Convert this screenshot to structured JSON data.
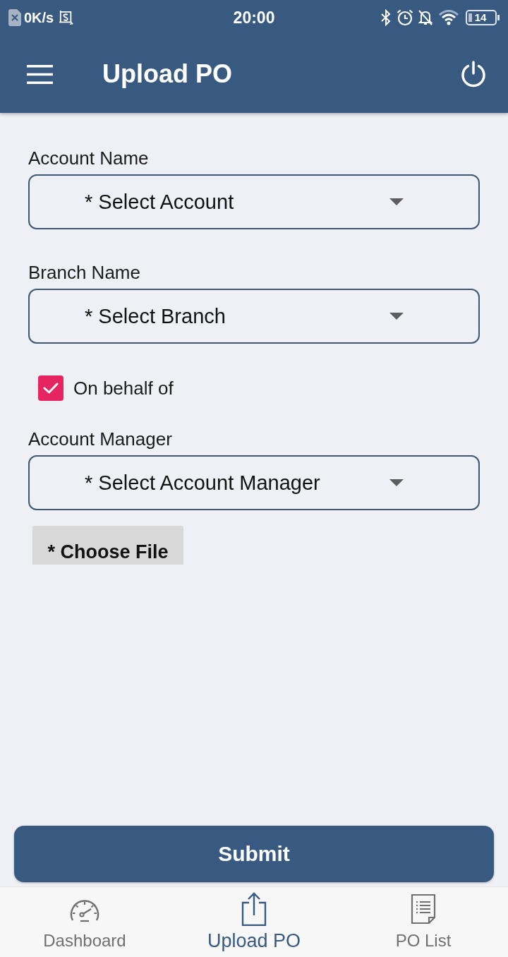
{
  "status_bar": {
    "network_speed": "0K/s",
    "time": "20:00",
    "battery": "14"
  },
  "app_bar": {
    "title": "Upload PO"
  },
  "form": {
    "fields": [
      {
        "kind": "dropdown",
        "label": "Account Name",
        "placeholder": "* Select Account"
      },
      {
        "kind": "dropdown",
        "label": "Branch Name",
        "placeholder": "* Select Branch"
      },
      {
        "kind": "checkbox",
        "label": "On behalf of",
        "checked": true
      },
      {
        "kind": "dropdown",
        "label": "Account Manager",
        "placeholder": "* Select Account Manager"
      },
      {
        "kind": "file",
        "label": "* Choose File"
      }
    ]
  },
  "submit": {
    "label": "Submit"
  },
  "bottom_nav": [
    {
      "label": "Dashboard",
      "selected": false
    },
    {
      "label": "Upload PO",
      "selected": true
    },
    {
      "label": "PO List",
      "selected": false
    }
  ]
}
